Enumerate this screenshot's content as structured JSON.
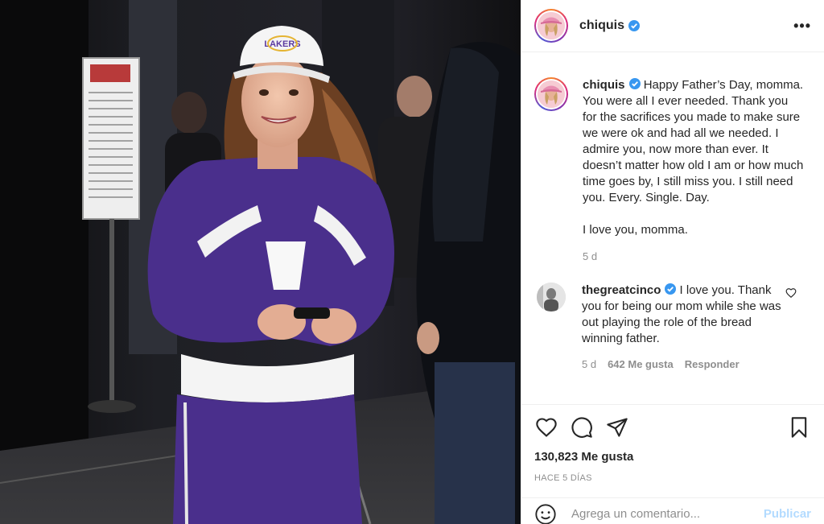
{
  "post": {
    "image_alt": "Woman in purple tracksuit and white Lakers cap smiling"
  },
  "header": {
    "username": "chiquis",
    "more": "•••"
  },
  "caption": {
    "username": "chiquis",
    "text": "Happy Father’s Day, momma. You were all I ever needed. Thank you for the sacrifices you made to make sure we were ok and had all we needed. I admire you, now more than ever. It doesn’t matter how old I am or how much time goes by, I still miss you. I still need you. Every. Single. Day.",
    "text2": "I love you, momma.",
    "age": "5 d"
  },
  "comments": [
    {
      "username": "thegreatcinco",
      "text": "I love you. Thank you for being our mom while she was out playing the role of the bread winning father.",
      "age": "5 d",
      "likes": "642 Me gusta",
      "reply": "Responder"
    }
  ],
  "stats": {
    "likes": "130,823 Me gusta",
    "ago": "HACE 5 DÍAS"
  },
  "add_comment": {
    "placeholder": "Agrega un comentario...",
    "publish": "Publicar"
  },
  "colors": {
    "verified": "#3897f0",
    "publish": "#b3dbff",
    "muted": "#8e8e8e"
  },
  "icons": {
    "like": "heart-icon",
    "comment": "comment-icon",
    "share": "paper-plane-icon",
    "save": "bookmark-icon",
    "emoji": "smiley-icon",
    "more": "more-options-icon"
  }
}
